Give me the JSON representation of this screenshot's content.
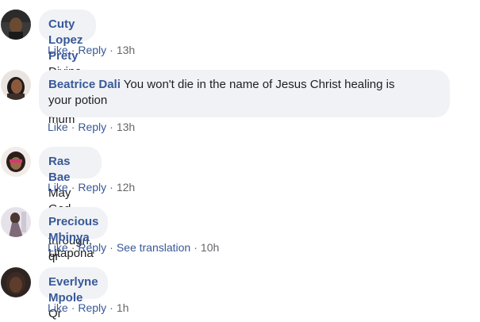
{
  "comments": [
    {
      "author": "Cuty Lopez Prety",
      "text": "Divine healing to you mum",
      "actions": {
        "like": "Like",
        "reply": "Reply",
        "time": "13h"
      }
    },
    {
      "author": "Beatrice Dali",
      "text": "You won't die in the name of Jesus Christ healing is",
      "text_line2": "your potion",
      "actions": {
        "like": "Like",
        "reply": "Reply",
        "time": "13h"
      }
    },
    {
      "author": "Ras Bae",
      "text": "May God see u through, qr",
      "actions": {
        "like": "Like",
        "reply": "Reply",
        "time": "12h"
      }
    },
    {
      "author": "Precious Mbinya",
      "text": "Utapona",
      "actions": {
        "like": "Like",
        "reply": "Reply",
        "translate": "See translation",
        "time": "10h"
      }
    },
    {
      "author": "Everlyne Mpole",
      "text": "Qr",
      "actions": {
        "like": "Like",
        "reply": "Reply",
        "time": "1h"
      }
    }
  ],
  "separator": "·",
  "colors": {
    "link": "#385898",
    "bubble": "#f0f2f5",
    "meta": "#65676b"
  }
}
